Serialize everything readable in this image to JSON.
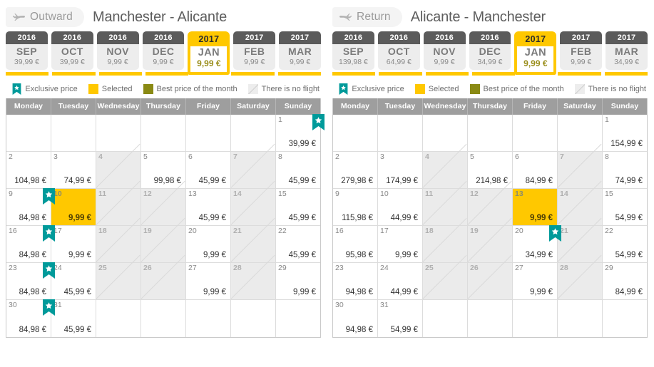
{
  "legend": {
    "exclusive": "Exclusive price",
    "selected": "Selected",
    "best": "Best price of the month",
    "noflight": "There is no flight"
  },
  "weekdays": [
    "Monday",
    "Tuesday",
    "Wednesday",
    "Thursday",
    "Friday",
    "Saturday",
    "Sunday"
  ],
  "colors": {
    "selected": "#ffc800",
    "best": "#8a8a14",
    "exclusive": "#009a9a",
    "noflight": "#ebebeb",
    "header": "#9e9e9e",
    "tab_year": "#5b5b5b"
  },
  "panels": [
    {
      "direction_label": "Outward",
      "direction_icon": "plane-right-icon",
      "route": "Manchester - Alicante",
      "months": [
        {
          "year": "2016",
          "month": "SEP",
          "price": "39,99 €",
          "active": false
        },
        {
          "year": "2016",
          "month": "OCT",
          "price": "39,99 €",
          "active": false
        },
        {
          "year": "2016",
          "month": "NOV",
          "price": "9,99 €",
          "active": false
        },
        {
          "year": "2016",
          "month": "DEC",
          "price": "9,99 €",
          "active": false
        },
        {
          "year": "2017",
          "month": "JAN",
          "price": "9,99 €",
          "active": true
        },
        {
          "year": "2017",
          "month": "FEB",
          "price": "9,99 €",
          "active": false
        },
        {
          "year": "2017",
          "month": "MAR",
          "price": "9,99 €",
          "active": false
        }
      ],
      "weeks": [
        [
          {
            "state": "empty"
          },
          {
            "state": "empty"
          },
          {
            "state": "empty"
          },
          {
            "state": "empty"
          },
          {
            "state": "empty"
          },
          {
            "state": "empty"
          },
          {
            "day": "1",
            "price": "39,99 €",
            "state": "normal",
            "exclusive": true
          }
        ],
        [
          {
            "day": "2",
            "price": "104,98 €",
            "state": "normal"
          },
          {
            "day": "3",
            "price": "74,99 €",
            "state": "normal"
          },
          {
            "day": "4",
            "price": "",
            "state": "noflight"
          },
          {
            "day": "5",
            "price": "99,98 €",
            "state": "normal"
          },
          {
            "day": "6",
            "price": "45,99 €",
            "state": "normal"
          },
          {
            "day": "7",
            "price": "",
            "state": "noflight"
          },
          {
            "day": "8",
            "price": "45,99 €",
            "state": "normal"
          }
        ],
        [
          {
            "day": "9",
            "price": "84,98 €",
            "state": "normal",
            "exclusive": true
          },
          {
            "day": "10",
            "price": "9,99 €",
            "state": "selected"
          },
          {
            "day": "11",
            "price": "",
            "state": "noflight"
          },
          {
            "day": "12",
            "price": "",
            "state": "noflight"
          },
          {
            "day": "13",
            "price": "45,99 €",
            "state": "normal"
          },
          {
            "day": "14",
            "price": "",
            "state": "noflight"
          },
          {
            "day": "15",
            "price": "45,99 €",
            "state": "normal"
          }
        ],
        [
          {
            "day": "16",
            "price": "84,98 €",
            "state": "normal",
            "exclusive": true
          },
          {
            "day": "17",
            "price": "9,99 €",
            "state": "normal"
          },
          {
            "day": "18",
            "price": "",
            "state": "noflight"
          },
          {
            "day": "19",
            "price": "",
            "state": "noflight"
          },
          {
            "day": "20",
            "price": "9,99 €",
            "state": "normal"
          },
          {
            "day": "21",
            "price": "",
            "state": "noflight"
          },
          {
            "day": "22",
            "price": "45,99 €",
            "state": "normal"
          }
        ],
        [
          {
            "day": "23",
            "price": "84,98 €",
            "state": "normal",
            "exclusive": true
          },
          {
            "day": "24",
            "price": "45,99 €",
            "state": "normal"
          },
          {
            "day": "25",
            "price": "",
            "state": "noflight"
          },
          {
            "day": "26",
            "price": "",
            "state": "noflight"
          },
          {
            "day": "27",
            "price": "9,99 €",
            "state": "normal"
          },
          {
            "day": "28",
            "price": "",
            "state": "noflight"
          },
          {
            "day": "29",
            "price": "9,99 €",
            "state": "normal"
          }
        ],
        [
          {
            "day": "30",
            "price": "84,98 €",
            "state": "normal",
            "exclusive": true
          },
          {
            "day": "31",
            "price": "45,99 €",
            "state": "normal"
          },
          {
            "state": "empty"
          },
          {
            "state": "empty"
          },
          {
            "state": "empty"
          },
          {
            "state": "empty"
          },
          {
            "state": "empty"
          }
        ]
      ]
    },
    {
      "direction_label": "Return",
      "direction_icon": "plane-left-icon",
      "route": "Alicante - Manchester",
      "months": [
        {
          "year": "2016",
          "month": "SEP",
          "price": "139,98 €",
          "active": false
        },
        {
          "year": "2016",
          "month": "OCT",
          "price": "64,99 €",
          "active": false
        },
        {
          "year": "2016",
          "month": "NOV",
          "price": "9,99 €",
          "active": false
        },
        {
          "year": "2016",
          "month": "DEC",
          "price": "34,99 €",
          "active": false
        },
        {
          "year": "2017",
          "month": "JAN",
          "price": "9,99 €",
          "active": true
        },
        {
          "year": "2017",
          "month": "FEB",
          "price": "9,99 €",
          "active": false
        },
        {
          "year": "2017",
          "month": "MAR",
          "price": "34,99 €",
          "active": false
        }
      ],
      "weeks": [
        [
          {
            "state": "empty"
          },
          {
            "state": "empty"
          },
          {
            "state": "empty"
          },
          {
            "state": "empty"
          },
          {
            "state": "empty"
          },
          {
            "state": "empty"
          },
          {
            "day": "1",
            "price": "154,99 €",
            "state": "normal"
          }
        ],
        [
          {
            "day": "2",
            "price": "279,98 €",
            "state": "normal"
          },
          {
            "day": "3",
            "price": "174,99 €",
            "state": "normal"
          },
          {
            "day": "4",
            "price": "",
            "state": "noflight"
          },
          {
            "day": "5",
            "price": "214,98 €",
            "state": "normal"
          },
          {
            "day": "6",
            "price": "84,99 €",
            "state": "normal"
          },
          {
            "day": "7",
            "price": "",
            "state": "noflight"
          },
          {
            "day": "8",
            "price": "74,99 €",
            "state": "normal"
          }
        ],
        [
          {
            "day": "9",
            "price": "115,98 €",
            "state": "normal"
          },
          {
            "day": "10",
            "price": "44,99 €",
            "state": "normal"
          },
          {
            "day": "11",
            "price": "",
            "state": "noflight"
          },
          {
            "day": "12",
            "price": "",
            "state": "noflight"
          },
          {
            "day": "13",
            "price": "9,99 €",
            "state": "selected"
          },
          {
            "day": "14",
            "price": "",
            "state": "noflight"
          },
          {
            "day": "15",
            "price": "54,99 €",
            "state": "normal"
          }
        ],
        [
          {
            "day": "16",
            "price": "95,98 €",
            "state": "normal"
          },
          {
            "day": "17",
            "price": "9,99 €",
            "state": "normal"
          },
          {
            "day": "18",
            "price": "",
            "state": "noflight"
          },
          {
            "day": "19",
            "price": "",
            "state": "noflight"
          },
          {
            "day": "20",
            "price": "34,99 €",
            "state": "normal",
            "exclusive": true
          },
          {
            "day": "21",
            "price": "",
            "state": "noflight"
          },
          {
            "day": "22",
            "price": "54,99 €",
            "state": "normal"
          }
        ],
        [
          {
            "day": "23",
            "price": "94,98 €",
            "state": "normal"
          },
          {
            "day": "24",
            "price": "44,99 €",
            "state": "normal"
          },
          {
            "day": "25",
            "price": "",
            "state": "noflight"
          },
          {
            "day": "26",
            "price": "",
            "state": "noflight"
          },
          {
            "day": "27",
            "price": "9,99 €",
            "state": "normal"
          },
          {
            "day": "28",
            "price": "",
            "state": "noflight"
          },
          {
            "day": "29",
            "price": "84,99 €",
            "state": "normal"
          }
        ],
        [
          {
            "day": "30",
            "price": "94,98 €",
            "state": "normal"
          },
          {
            "day": "31",
            "price": "54,99 €",
            "state": "normal"
          },
          {
            "state": "empty"
          },
          {
            "state": "empty"
          },
          {
            "state": "empty"
          },
          {
            "state": "empty"
          },
          {
            "state": "empty"
          }
        ]
      ]
    }
  ]
}
